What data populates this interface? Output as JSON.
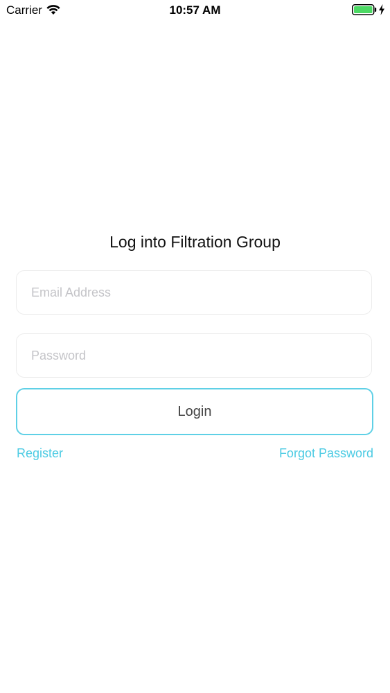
{
  "status_bar": {
    "carrier": "Carrier",
    "time": "10:57 AM",
    "icons": [
      "wifi-icon",
      "battery-icon",
      "charge-icon"
    ]
  },
  "login": {
    "title": "Log into Filtration Group",
    "email_placeholder": "Email Address",
    "password_placeholder": "Password",
    "login_label": "Login",
    "register_label": "Register",
    "forgot_label": "Forgot Password"
  },
  "colors": {
    "accent": "#4ccbe3",
    "button_border": "#5fd0e6",
    "battery": "#4cd964"
  }
}
